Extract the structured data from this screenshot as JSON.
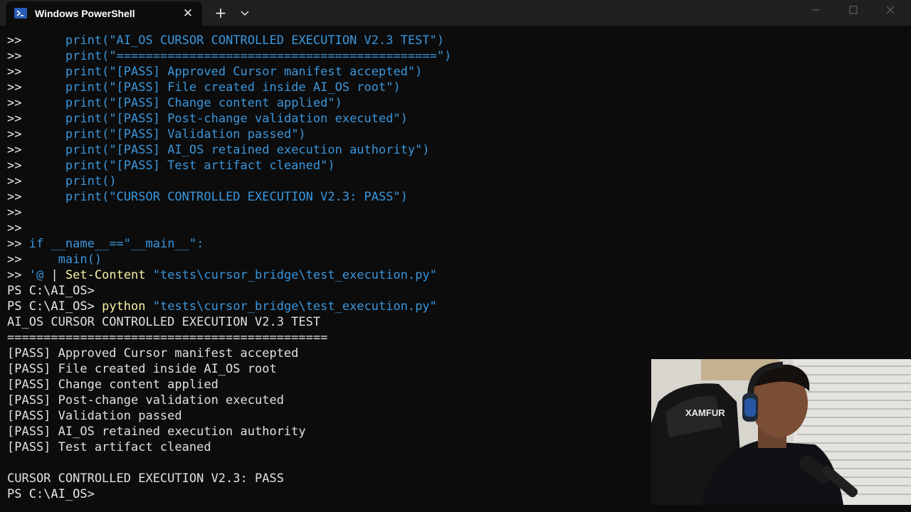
{
  "window": {
    "tab_title": "Windows PowerShell",
    "close_tab_glyph": "✕",
    "new_tab_glyph": "+",
    "icons": [
      "powershell-icon",
      "close-icon",
      "plus-icon",
      "chevron-down-icon",
      "minimize-icon",
      "maximize-icon",
      "close-window-icon"
    ]
  },
  "terminal": {
    "continuation_prompt": ">>",
    "script_lines": [
      "    print(\"AI_OS CURSOR CONTROLLED EXECUTION V2.3 TEST\")",
      "    print(\"============================================\")",
      "    print(\"[PASS] Approved Cursor manifest accepted\")",
      "    print(\"[PASS] File created inside AI_OS root\")",
      "    print(\"[PASS] Change content applied\")",
      "    print(\"[PASS] Post-change validation executed\")",
      "    print(\"[PASS] Validation passed\")",
      "    print(\"[PASS] AI_OS retained execution authority\")",
      "    print(\"[PASS] Test artifact cleaned\")",
      "    print()",
      "    print(\"CURSOR CONTROLLED EXECUTION V2.3: PASS\")",
      "",
      "",
      "if __name__==\"__main__\":",
      "    main()"
    ],
    "set_content_line": {
      "quote": "'@",
      "pipe": " | ",
      "cmdlet": "Set-Content",
      "path": " \"tests\\cursor_bridge\\test_execution.py\""
    },
    "prompt": "PS C:\\AI_OS>",
    "python_line": {
      "cmd": "python",
      "path": " \"tests\\cursor_bridge\\test_execution.py\""
    },
    "output_lines": [
      "AI_OS CURSOR CONTROLLED EXECUTION V2.3 TEST",
      "============================================",
      "[PASS] Approved Cursor manifest accepted",
      "[PASS] File created inside AI_OS root",
      "[PASS] Change content applied",
      "[PASS] Post-change validation executed",
      "[PASS] Validation passed",
      "[PASS] AI_OS retained execution authority",
      "[PASS] Test artifact cleaned",
      "",
      "CURSOR CONTROLLED EXECUTION V2.3: PASS"
    ],
    "final_prompt": "PS C:\\AI_OS>"
  },
  "webcam": {
    "chair_brand": "XAMFUR"
  }
}
